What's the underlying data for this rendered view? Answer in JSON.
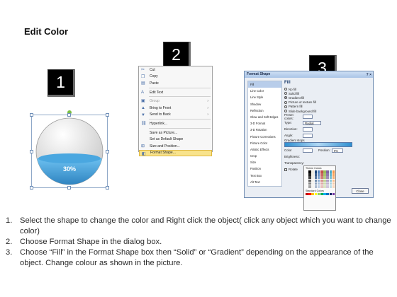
{
  "title": "Edit Color",
  "steps": [
    "1",
    "2",
    "3"
  ],
  "sphere": {
    "label": "30%",
    "fill_fraction": 0.3,
    "colors": {
      "top": "#e6e6e6",
      "bottom": "#2a87c9"
    }
  },
  "context_menu": {
    "items": [
      {
        "label": "Cut",
        "icon": "scissors-icon",
        "disabled": false
      },
      {
        "label": "Copy",
        "icon": "copy-icon",
        "disabled": false
      },
      {
        "label": "Paste",
        "icon": "paste-icon",
        "disabled": false
      },
      {
        "label": "Edit Text",
        "icon": "edit-text-icon",
        "disabled": false
      },
      {
        "label": "Group",
        "icon": "group-icon",
        "disabled": true,
        "submenu": true
      },
      {
        "label": "Bring to Front",
        "icon": "bring-front-icon",
        "disabled": false,
        "submenu": true
      },
      {
        "label": "Send to Back",
        "icon": "send-back-icon",
        "disabled": false,
        "submenu": true
      },
      {
        "label": "Hyperlink...",
        "icon": "hyperlink-icon",
        "disabled": false
      },
      {
        "label": "Save as Picture...",
        "icon": "",
        "disabled": false
      },
      {
        "label": "Set as Default Shape",
        "icon": "",
        "disabled": false
      },
      {
        "label": "Size and Position...",
        "icon": "size-icon",
        "disabled": false
      },
      {
        "label": "Format Shape...",
        "icon": "format-icon",
        "disabled": false,
        "highlighted": true
      }
    ]
  },
  "dialog": {
    "title": "Format Shape",
    "close_glyph": "? ×",
    "categories": [
      "Fill",
      "Line Color",
      "Line Style",
      "Shadow",
      "Reflection",
      "Glow and Soft Edges",
      "3-D Format",
      "3-D Rotation",
      "Picture Corrections",
      "Picture Color",
      "Artistic Effects",
      "Crop",
      "Size",
      "Position",
      "Text Box",
      "Alt Text"
    ],
    "selected_category": "Fill",
    "fill_header": "Fill",
    "fill_options": [
      "No fill",
      "Solid fill",
      "Gradient fill",
      "Picture or texture fill",
      "Pattern fill",
      "Slide background fill"
    ],
    "selected_fill": "Gradient fill",
    "rows": [
      {
        "label": "Preset colors:"
      },
      {
        "label": "Type:",
        "value": "Radial"
      },
      {
        "label": "Direction:"
      },
      {
        "label": "Angle:"
      }
    ],
    "gradient_stops_label": "Gradient stops",
    "color_label": "Color",
    "position_label": "Position:",
    "position_value": "0%",
    "brightness_label": "Brightness:",
    "transparency_label": "Transparency:",
    "rotate_label": "Rotate",
    "close_button": "Close",
    "theme_colors_label": "Theme Colors",
    "standard_colors_label": "Standard Colors"
  },
  "instructions": [
    {
      "num": "1.",
      "text": "Select the shape to change the color and Right click the object( click any object which you want to change color)"
    },
    {
      "num": "2.",
      "text": "Choose Format Shape in the dialog box."
    },
    {
      "num": "3.",
      "text": "Choose “Fill” in the Format Shape box then “Solid” or “Gradient” depending on the appearance of the object. Change colour as shown in the picture."
    }
  ]
}
